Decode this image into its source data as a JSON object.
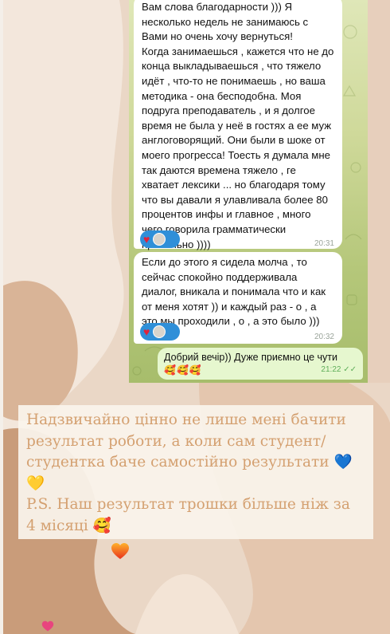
{
  "chat": {
    "message1": {
      "text": "Вам слова благодарности ))) Я\nнесколько недель не занимаюсь с\nВами но очень хочу вернуться!\nКогда занимаешься , кажется что не до\nконца выкладываешься , что тяжело\nидёт , что-то не понимаешь , но ваша\nметодика - она бесподобна. Моя\nподруга преподаватель , и я долгое\nвремя не была у неё в гостях а ее муж\nанглоговорящий. Они были в шоке от\nмоего прогресса! Тоесть я думала мне\nтак даются времена тяжело , ге\nхватает лексики ... но благодаря тому\nчто вы давали я улавливала более 80\nпроцентов инфы и главное , много\nчего говорила грамматически\nправильно ))))",
      "time": "20:31",
      "reaction_icon": "heart-icon"
    },
    "message2": {
      "text": "Если до этого я сидела молча , то\nсейчас спокойно поддерживала\nдиалог, вникала и понимала что и как\nот меня хотят )) и каждый раз - о , а\nэто мы проходили , о , а это было )))",
      "time": "20:32",
      "reaction_icon": "heart-icon"
    },
    "message3": {
      "text": "Добрий вечір)) Дуже приємно це чути",
      "emoji": "🥰🥰🥰",
      "time": "21:22",
      "status_icon": "double-check-icon"
    }
  },
  "caption": {
    "text": "Надзвичайно цінно не лише мені бачити\nрезультат роботи, а коли сам студент/\nстудентка баче самостійно результати 💙\n💛\nP.S. Наш результат трошки більше ніж за\n4 місяці 🥰"
  },
  "colors": {
    "background": "#ead7c6",
    "caption_text": "#d4a070",
    "reaction_badge": "#2f8fd8",
    "outgoing_bubble": "#e6f7cf"
  },
  "decorations": [
    "flame-heart-icon",
    "pink-heart-icon"
  ]
}
